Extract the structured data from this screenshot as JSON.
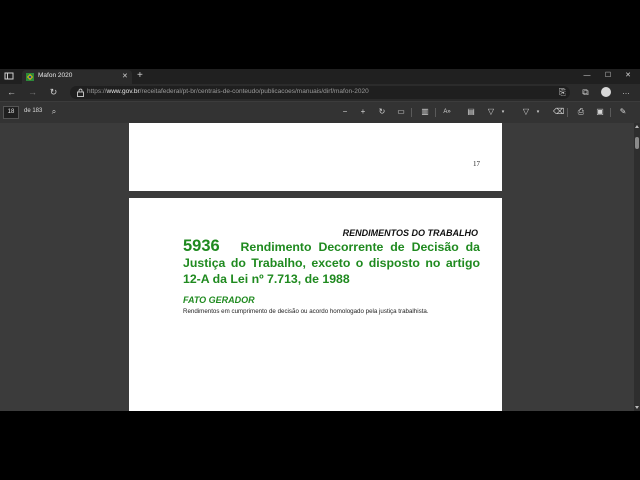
{
  "browser": {
    "tab": {
      "title": "Mafon 2020",
      "close": "✕"
    },
    "new_tab": "+",
    "window_controls": {
      "minimize": "—",
      "maximize": "☐",
      "close": "✕"
    },
    "address": {
      "host_prefix": "https://",
      "host": "www.gov.br",
      "path": "/receitafederal/pt-br/centrais-de-conteudo/publicacoes/manuais/dirf/mafon-2020"
    },
    "more": "…"
  },
  "pdf_toolbar": {
    "page_current": "18",
    "page_total": "de 183"
  },
  "document": {
    "prev_page_number": "17",
    "section_title": "RENDIMENTOS DO TRABALHO",
    "code": "5936",
    "heading": "Rendimento Decorrente de Decisão da Justiça do Trabalho, exceto o disposto no artigo 12-A da Lei nº 7.713, de 1988",
    "subheading": "FATO GERADOR",
    "body": "Rendimentos em cumprimento de decisão ou acordo homologado pela justiça trabalhista."
  },
  "colors": {
    "heading_green": "#1f8a1f",
    "viewport_bg": "#3b3b3b",
    "toolbar_bg": "#333333"
  }
}
